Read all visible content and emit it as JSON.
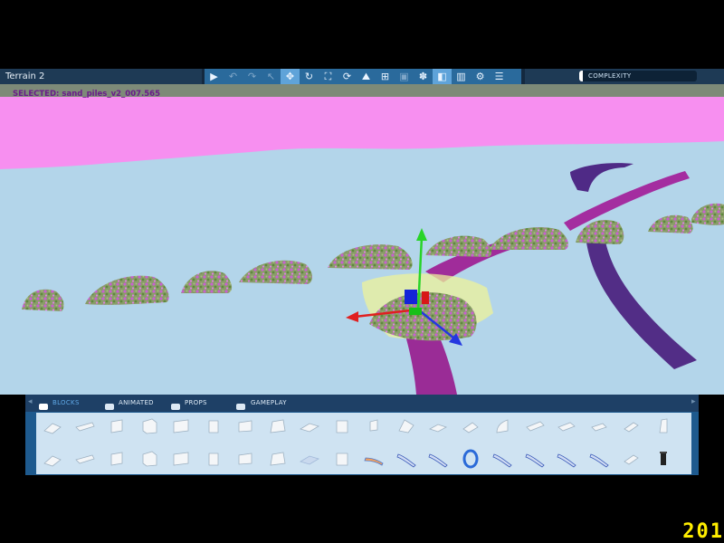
{
  "window": {
    "title": "Terrain 2"
  },
  "selection": {
    "text": "SELECTED: sand_piles_v2_007.565"
  },
  "toolbar": {
    "tools": [
      {
        "name": "play-icon",
        "glyph": "▶",
        "state": "normal"
      },
      {
        "name": "undo-icon",
        "glyph": "↶",
        "state": "dim"
      },
      {
        "name": "redo-icon",
        "glyph": "↷",
        "state": "dim"
      },
      {
        "name": "pointer-icon",
        "glyph": "↖",
        "state": "dim"
      },
      {
        "name": "move-icon",
        "glyph": "✥",
        "state": "active"
      },
      {
        "name": "rotate-icon",
        "glyph": "↻",
        "state": "normal"
      },
      {
        "name": "scale-icon",
        "glyph": "⛶",
        "state": "normal"
      },
      {
        "name": "refresh-icon",
        "glyph": "⟳",
        "state": "normal"
      },
      {
        "name": "terrain-icon",
        "glyph": "⛰",
        "state": "normal"
      },
      {
        "name": "snap-icon",
        "glyph": "⊞",
        "state": "normal"
      },
      {
        "name": "block-icon",
        "glyph": "▣",
        "state": "dim"
      },
      {
        "name": "animal-icon",
        "glyph": "✽",
        "state": "normal"
      },
      {
        "name": "split-view-icon",
        "glyph": "◧",
        "state": "active"
      },
      {
        "name": "layout-icon",
        "glyph": "▥",
        "state": "normal"
      },
      {
        "name": "settings-icon",
        "glyph": "⚙",
        "state": "normal"
      },
      {
        "name": "menu-icon",
        "glyph": "☰",
        "state": "normal"
      }
    ]
  },
  "complexity": {
    "label": "COMPLEXITY",
    "level": 0.03
  },
  "palette": {
    "tabs": [
      {
        "label": "BLOCKS",
        "icon": "blocks-icon",
        "active": true
      },
      {
        "label": "ANIMATED",
        "icon": "animated-icon",
        "active": false
      },
      {
        "label": "PROPS",
        "icon": "props-icon",
        "active": false
      },
      {
        "label": "GAMEPLAY",
        "icon": "gameplay-icon",
        "active": false
      }
    ],
    "item_count": 40
  },
  "hud": {
    "fps": "201"
  },
  "colors": {
    "sky": "#b3d5ea",
    "sand_overlay": "#f78ff0",
    "track_dark": "#5e2f8a",
    "track_magenta": "#a62c9c",
    "gizmo_x": "#e02020",
    "gizmo_y": "#28d428",
    "gizmo_z": "#2438e0",
    "fps": "#ffee00"
  }
}
